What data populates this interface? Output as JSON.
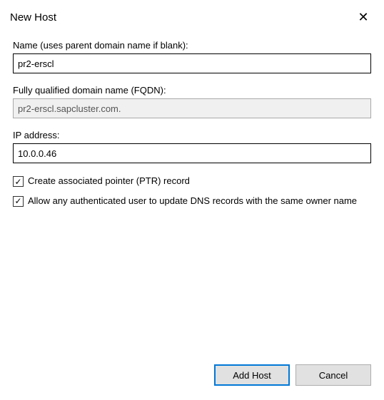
{
  "titlebar": {
    "title": "New Host"
  },
  "fields": {
    "name": {
      "label": "Name (uses parent domain name if blank):",
      "value": "pr2-erscl"
    },
    "fqdn": {
      "label": "Fully qualified domain name (FQDN):",
      "value": "pr2-erscl.sapcluster.com."
    },
    "ip": {
      "label": "IP address:",
      "value": "10.0.0.46"
    }
  },
  "checkboxes": {
    "ptr": {
      "label": "Create associated pointer (PTR) record",
      "checked_glyph": "✓"
    },
    "allow": {
      "label": "Allow any authenticated user to update DNS records with the same owner name",
      "checked_glyph": "✓"
    }
  },
  "buttons": {
    "add_host": "Add Host",
    "cancel": "Cancel"
  },
  "icons": {
    "close_glyph": "✕"
  }
}
